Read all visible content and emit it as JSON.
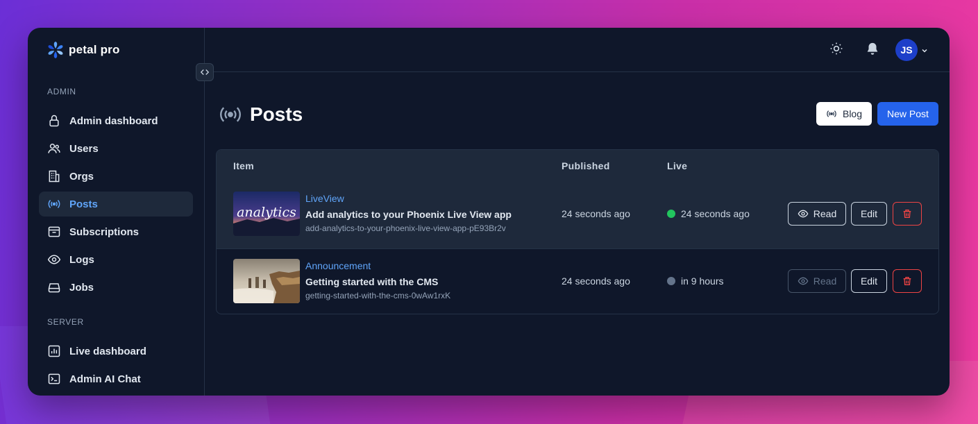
{
  "brand": {
    "name": "petal pro",
    "accent": "#2563eb",
    "link": "#60a5fa"
  },
  "sidebar": {
    "sections": [
      {
        "title": "ADMIN"
      },
      {
        "title": "SERVER"
      }
    ],
    "items": [
      {
        "label": "Admin dashboard",
        "icon": "lock-icon"
      },
      {
        "label": "Users",
        "icon": "users-icon"
      },
      {
        "label": "Orgs",
        "icon": "building-icon"
      },
      {
        "label": "Posts",
        "icon": "signal-icon",
        "active": true
      },
      {
        "label": "Subscriptions",
        "icon": "archive-icon"
      },
      {
        "label": "Logs",
        "icon": "eye-icon"
      },
      {
        "label": "Jobs",
        "icon": "inbox-icon"
      },
      {
        "label": "Live dashboard",
        "icon": "chart-icon"
      },
      {
        "label": "Admin AI Chat",
        "icon": "terminal-icon"
      }
    ]
  },
  "topbar": {
    "avatar_initials": "JS"
  },
  "page": {
    "title": "Posts",
    "blog_label": "Blog",
    "new_post_label": "New Post"
  },
  "table": {
    "headers": [
      "Item",
      "Published",
      "Live"
    ],
    "rows": [
      {
        "category": "LiveView",
        "title": "Add analytics to your Phoenix Live View app",
        "slug": "add-analytics-to-your-phoenix-live-view-app-pE93Br2v",
        "published": "24 seconds ago",
        "live": "24 seconds ago",
        "live_color": "#22c55e",
        "read_label": "Read",
        "edit_label": "Edit",
        "thumb_text": "analytics"
      },
      {
        "category": "Announcement",
        "title": "Getting started with the CMS",
        "slug": "getting-started-with-the-cms-0wAw1rxK",
        "published": "24 seconds ago",
        "live": "in 9 hours",
        "live_color": "#64748b",
        "read_label": "Read",
        "edit_label": "Edit"
      }
    ]
  }
}
